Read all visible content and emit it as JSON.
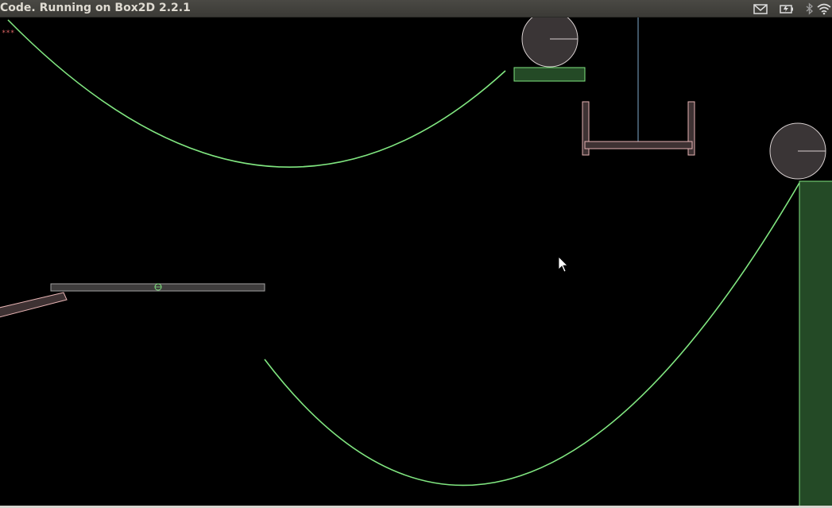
{
  "window": {
    "title": "Code. Running on Box2D 2.2.1"
  },
  "tray": {
    "icons": [
      "mail-icon",
      "battery-icon",
      "bluetooth-icon",
      "wifi-icon"
    ]
  },
  "canvas": {
    "background": "#000000",
    "debug_marker": "***"
  },
  "colors": {
    "static_body": "#80e680",
    "static_fill": "#244a26",
    "dynamic_outline": "#e6b3b3",
    "dynamic_fill": "#3e3233",
    "joint": "#80cccc",
    "plank": "#9a9a9a"
  }
}
